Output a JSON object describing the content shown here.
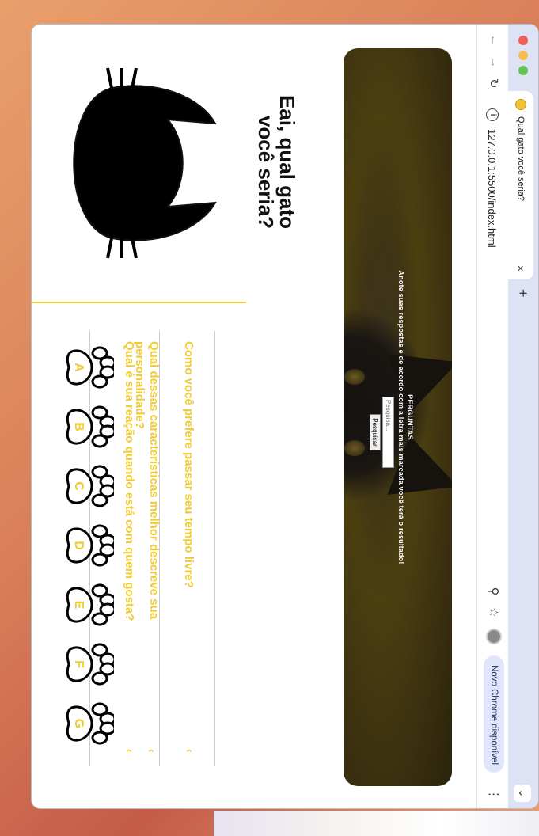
{
  "browser": {
    "tab_title": "Qual gato você seria?",
    "tab_close": "×",
    "new_tab": "+",
    "url": "127.0.0.1:5500/index.html",
    "update_label": "Novo Chrome disponível",
    "tabs_menu": "⌄"
  },
  "hero": {
    "heading": "PERGUNTAS",
    "subheading": "Anote suas respostas e de acordo com a letra mais marcada você terá o resultado!",
    "search_placeholder": "Pesquisa...",
    "search_button": "Pesquisar"
  },
  "page": {
    "title": "Eai, qual gato você seria?"
  },
  "questions": [
    {
      "text": "Como você prefere passar seu tempo livre?",
      "chevron": "‹"
    },
    {
      "text": "Qual dessas características melhor descreve sua personalidade?",
      "chevron": "‹"
    },
    {
      "text": "Qual é sua reação quando está com quem gosta?",
      "chevron": "‹"
    }
  ],
  "options": [
    "A",
    "B",
    "C",
    "D",
    "E",
    "F",
    "G"
  ],
  "colors": {
    "accent": "#f2cb31",
    "hero_bg": "#3f3414",
    "title": "#111111"
  },
  "icons": {
    "back": "arrow-left-icon",
    "forward": "arrow-right-icon",
    "reload": "reload-icon",
    "info": "info-icon",
    "zoom": "zoom-icon",
    "bookmark": "star-icon",
    "menu": "kebab-menu-icon"
  }
}
